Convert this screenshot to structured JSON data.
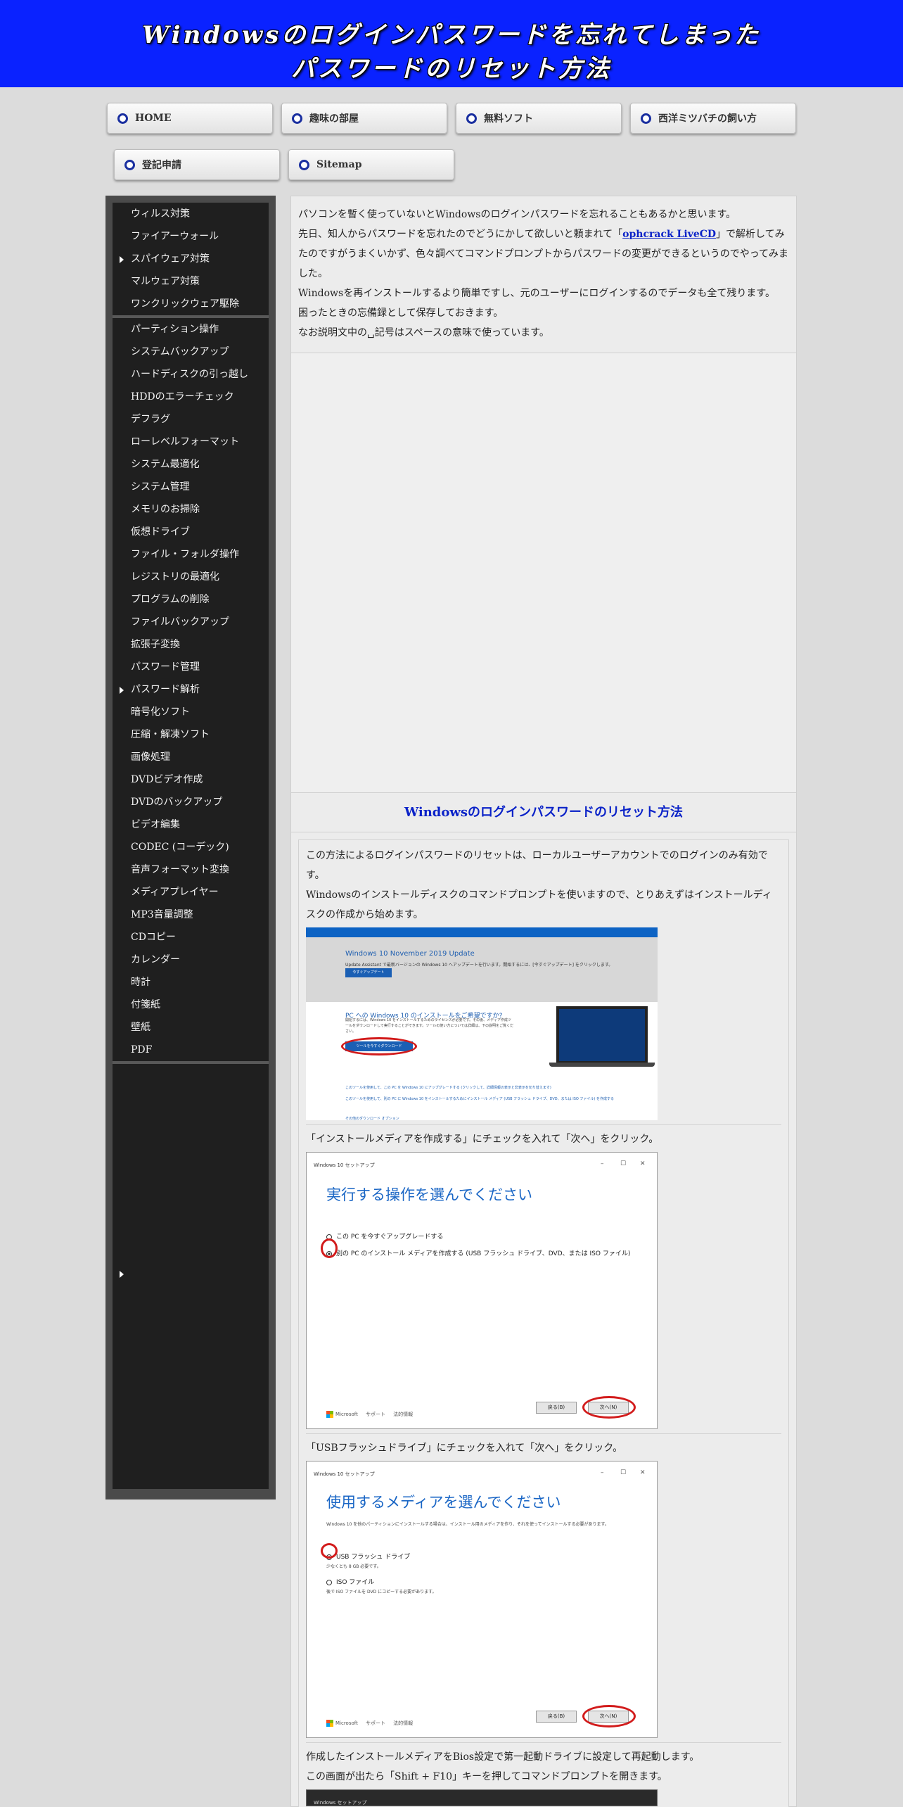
{
  "header": {
    "title_line1": "Windowsのログインパスワードを忘れてしまった",
    "title_line2": "パスワードのリセット方法"
  },
  "nav": [
    {
      "label": "HOME"
    },
    {
      "label": "趣味の部屋"
    },
    {
      "label": "無料ソフト"
    },
    {
      "label": "西洋ミツバチの飼い方"
    },
    {
      "label": "登記申請"
    },
    {
      "label": "Sitemap"
    }
  ],
  "sidebar": {
    "group1": [
      "ウィルス対策",
      "ファイアーウォール",
      "スパイウェア対策",
      "マルウェア対策",
      "ワンクリックウェア駆除"
    ],
    "group2": [
      "パーティション操作",
      "システムバックアップ",
      "ハードディスクの引っ越し",
      "HDDのエラーチェック",
      "デフラグ",
      "ローレベルフォーマット",
      "システム最適化",
      "システム管理",
      "メモリのお掃除",
      "仮想ドライブ",
      "ファイル・フォルダ操作",
      "レジストリの最適化",
      "プログラムの削除",
      "ファイルバックアップ",
      "拡張子変換",
      "パスワード管理",
      "パスワード解析",
      "暗号化ソフト",
      "圧縮・解凍ソフト",
      "画像処理",
      "DVDビデオ作成",
      "DVDのバックアップ",
      "ビデオ編集",
      "CODEC (コーデック)",
      "音声フォーマット変換",
      "メディアプレイヤー",
      "MP3音量調整",
      "CDコピー",
      "カレンダー",
      "時計",
      "付箋紙",
      "壁紙",
      "PDF"
    ]
  },
  "intro": {
    "p1": "パソコンを暫く使っていないとWindowsのログインパスワードを忘れることもあるかと思います。",
    "p2_before": "先日、知人からパスワードを忘れたのでどうにかして欲しいと頼まれて「",
    "p2_link": "ophcrack LiveCD",
    "p2_after": "」で解析してみたのですがうまくいかず、色々調べてコマンドプロンプトからパスワードの変更ができるというのでやってみました。",
    "p3": "Windowsを再インストールするより簡単ですし、元のユーザーにログインするのでデータも全て残ります。",
    "p4": "困ったときの忘備録として保存しておきます。",
    "p5": "なお説明文中の␣記号はスペースの意味で使っています。"
  },
  "section_title": "Windowsのログインパスワードのリセット方法",
  "step1": {
    "p1": "この方法によるログインパスワードのリセットは、ローカルユーザーアカウントでのログインのみ有効です。",
    "p2": "Windowsのインストールディスクのコマンドプロンプトを使いますので、とりあえずはインストールディスクの作成から始めます。",
    "shot": {
      "h1": "Windows 10 November 2019 Update",
      "p": "Update Assistant で最新バージョンの Windows 10 へアップデートを行います。開始するには、[今すぐアップデート] をクリックします。",
      "btn": "今すぐアップデート",
      "h2": "PC への Windows 10 のインストールをご希望ですか?",
      "p2": "開始するには、Windows 10 をインストールするためのライセンスが必要です。その後、メディア作成ツールをダウンロードして実行することができます。ツールの使い方については詳細は、下の説明をご覧ください。",
      "btn2": "ツールを今すぐダウンロード",
      "opt1": "このツールを使用して、この PC を Windows 10 にアップグレードする (クリックして、詳細情報の表示と非表示を切り替えます)",
      "opt2": "このツールを使用して、別の PC に Windows 10 をインストールするためにインストール メディア (USB フラッシュ ドライブ、DVD、または ISO ファイル) を作成する",
      "opt3": "その他のダウンロード オプション"
    }
  },
  "step2": {
    "text": "「インストールメディアを作成する」にチェックを入れて「次へ」をクリック。",
    "shot": {
      "title": "Windows 10 セットアップ",
      "heading": "実行する操作を選んでください",
      "option1": "この PC を今すぐアップグレードする",
      "option2": "別の PC のインストール メディアを作成する (USB フラッシュ ドライブ、DVD、または ISO ファイル)",
      "footer_logo": "Microsoft",
      "footer_support": "サポート",
      "footer_legal": "法的情報",
      "back": "戻る(B)",
      "next": "次へ(N)"
    }
  },
  "step3": {
    "text": "「USBフラッシュドライブ」にチェックを入れて「次へ」をクリック。",
    "shot": {
      "title": "Windows 10 セットアップ",
      "heading": "使用するメディアを選んでください",
      "desc": "Windows 10 を他のパーティションにインストールする場合は、インストール用のメディアを作り、それを使ってインストールする必要があります。",
      "option1": "USB フラッシュ ドライブ",
      "option1_note": "少なくとも 8 GB 必要です。",
      "option2": "ISO ファイル",
      "option2_note": "後で ISO ファイルを DVD にコピーする必要があります。",
      "footer_logo": "Microsoft",
      "footer_support": "サポート",
      "footer_legal": "法的情報",
      "back": "戻る(B)",
      "next": "次へ(N)"
    }
  },
  "step4": {
    "p1": "作成したインストールメディアをBios設定で第一起動ドライブに設定して再起動します。",
    "p2": "この画面が出たら「Shift + F10」キーを押してコマンドプロンプトを開きます。",
    "shot_title": "Windows セットアップ"
  }
}
